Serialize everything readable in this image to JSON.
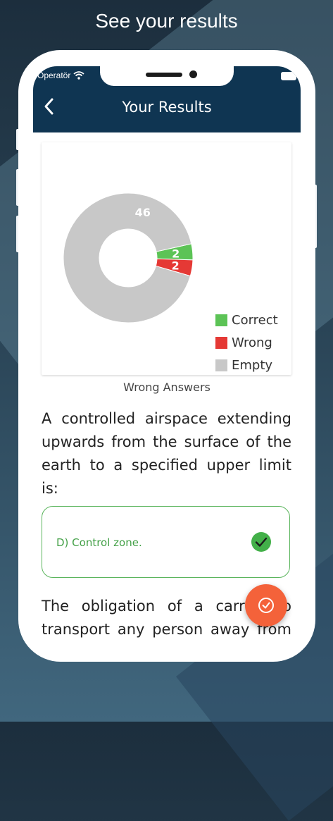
{
  "headline": "See your results",
  "status_bar": {
    "carrier": "Operatör"
  },
  "app_bar": {
    "title": "Your Results"
  },
  "chart_data": {
    "type": "pie",
    "donut": true,
    "slices": [
      {
        "label": "Correct",
        "value": 2,
        "color": "#5cc356"
      },
      {
        "label": "Wrong",
        "value": 2,
        "color": "#e53935"
      },
      {
        "label": "Empty",
        "value": 46,
        "color": "#c8c8c8"
      }
    ],
    "legend": [
      "Correct",
      "Wrong",
      "Empty"
    ],
    "legend_position": "bottom-right"
  },
  "section_label": "Wrong Answers",
  "questions": [
    {
      "text": "A controlled airspace extending upwards from the surface of the earth to a specified upper limit is:",
      "answer": "D) Control zone."
    },
    {
      "text": "The obligation of a carrier to transport any person away from the"
    }
  ],
  "colors": {
    "app_bar": "#0f3552",
    "correct_border": "#5bb55d",
    "fab": "#f4623a"
  },
  "icons": {
    "back": "chevron-left-icon",
    "check": "check-circle-icon",
    "fab": "check-circle-outline-icon"
  }
}
